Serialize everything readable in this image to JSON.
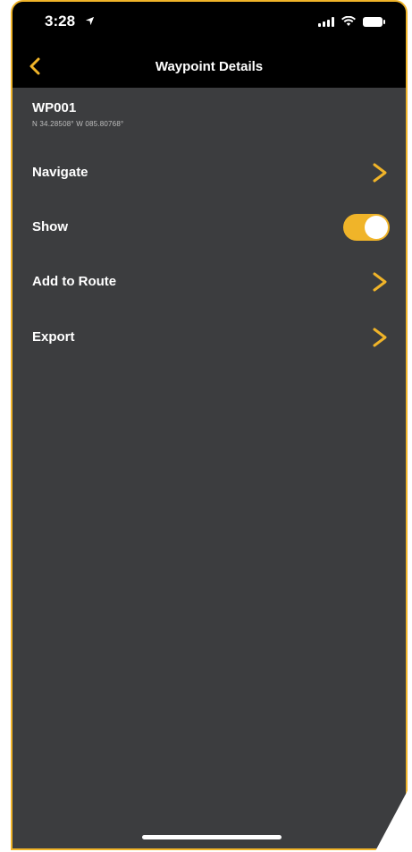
{
  "status_bar": {
    "time": "3:28",
    "location_icon": "location-arrow-icon",
    "signal_icon": "signal-icon",
    "wifi_icon": "wifi-icon",
    "battery_icon": "battery-icon"
  },
  "nav": {
    "back_icon": "chevron-left-icon",
    "title": "Waypoint Details"
  },
  "waypoint": {
    "name": "WP001",
    "coordinates": "N 34.28508°  W 085.80768°"
  },
  "menu": {
    "items": [
      {
        "label": "Navigate",
        "control": "chevron"
      },
      {
        "label": "Show",
        "control": "toggle",
        "on": true
      },
      {
        "label": "Add to Route",
        "control": "chevron"
      },
      {
        "label": "Export",
        "control": "chevron"
      }
    ]
  },
  "colors": {
    "accent": "#f0b429",
    "background": "#3c3d3f",
    "bar": "#000000",
    "text": "#ffffff"
  }
}
